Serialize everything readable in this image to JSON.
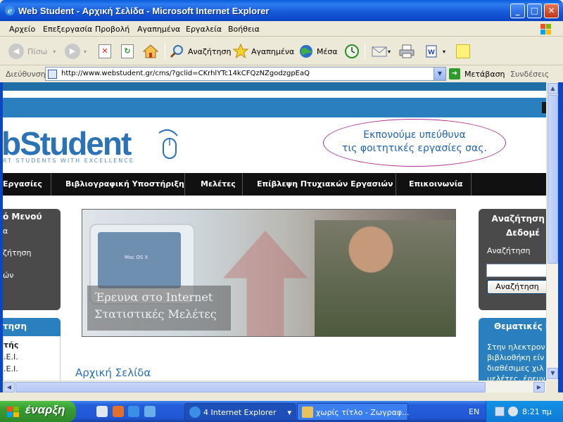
{
  "window": {
    "title": "Web Student - Αρχική Σελίδα - Microsoft Internet Explorer",
    "minimize": "_",
    "maximize": "□",
    "close": "✕"
  },
  "menu": [
    "Αρχείο",
    "Επεξεργασία",
    "Προβολή",
    "Αγαπημένα",
    "Εργαλεία",
    "Βοήθεια"
  ],
  "toolbar": {
    "back": "Πίσω",
    "search": "Αναζήτηση",
    "favorites": "Αγαπημένα",
    "media": "Μέσα"
  },
  "address": {
    "label": "Διεύθυνση",
    "url": "http://www.webstudent.gr/cms/?gclid=CKrhlYTc14kCFQzNZgodzgpEaQ",
    "go": "Μετάβαση",
    "links": "Συνδέσεις"
  },
  "page": {
    "logo": "bStudent",
    "tagline": "RT STUDENTS WITH EXCELLENCE",
    "slogan_line1": "Εκπονούμε υπεύθυνα",
    "slogan_line2": "τις φοιτητικές εργασίες σας.",
    "nav": [
      "Εργασίες",
      "Βιβλιογραφική Υποστήριξη",
      "Μελέτες",
      "Επίβλεψη Πτυχιακών Εργασιών",
      "Επικοινωνία"
    ],
    "left_menu": {
      "heading": "ό Μενού",
      "items": [
        "α",
        "ζήτηση",
        "ών"
      ]
    },
    "left_panel2": {
      "heading": "τηση",
      "items": [
        "τής",
        ".Ε.Ι.",
        ".Ε.Ι."
      ]
    },
    "hero_caption_line1": "Έρευνα στο Internet",
    "hero_caption_line2": "Στατιστικές Μελέτες",
    "hero_screen_text": "Mac OS X",
    "page_title": "Αρχική Σελίδα",
    "search_panel": {
      "heading_line1": "Αναζήτηση σ",
      "heading_line2": "Δεδομέ",
      "label": "Αναζήτηση",
      "input_value": "",
      "button": "Αναζήτηση"
    },
    "topics_panel": {
      "heading": "Θεματικές Ε",
      "lines": [
        "Στην ηλεκτρον",
        "βιβλιοθήκη είν",
        "διαθέσιμες χιλ",
        "μελέτες, έρευν"
      ]
    }
  },
  "taskbar": {
    "start": "έναρξη",
    "tasks": [
      {
        "label": "4 Internet Explorer",
        "arrow": "▾"
      },
      {
        "label": "χωρίς τίτλο - Ζωγραφ..."
      }
    ],
    "language": "EN",
    "clock": "8:21 πμ"
  },
  "colors": {
    "xp_blue": "#0b46c4",
    "site_blue": "#2a7fbf",
    "nav_black": "#111111",
    "panel_gray": "#4a4a4a",
    "start_green": "#389a32"
  }
}
